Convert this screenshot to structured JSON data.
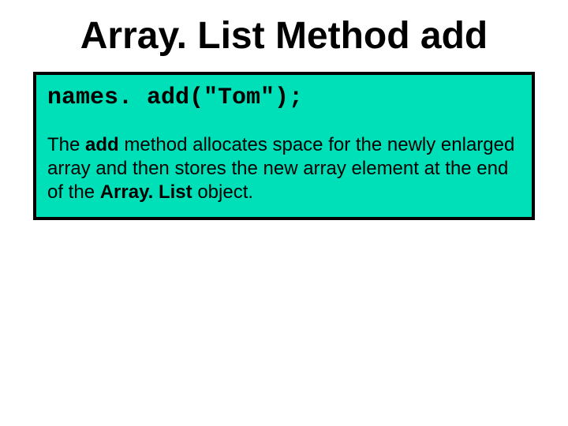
{
  "slide": {
    "title": "Array. List Method add",
    "code": "names. add(\"Tom\");",
    "desc": {
      "part1": "The ",
      "bold1": "add",
      "part2": " method allocates space for the newly enlarged array and then stores the new array element at the end of the ",
      "bold2": "Array. List",
      "part3": " object."
    }
  }
}
